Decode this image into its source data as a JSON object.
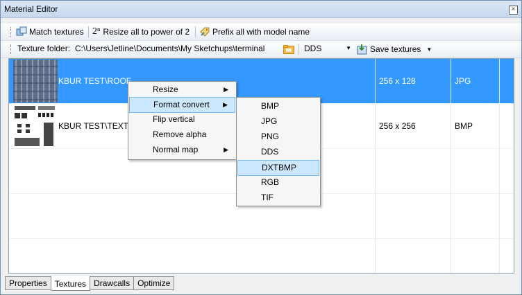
{
  "window": {
    "title": "Material Editor"
  },
  "toolbar1": {
    "match_textures": "Match textures",
    "resize_power2": "Resize all to power of 2",
    "power_symbol": "2ⁿ",
    "prefix_model_name": "Prefix all with model name"
  },
  "toolbar2": {
    "texture_folder_label": "Texture folder:",
    "texture_folder_path": "C:\\Users\\Jetline\\Documents\\My Sketchups\\terminal",
    "format_select": "DDS",
    "save_textures": "Save textures"
  },
  "textures": [
    {
      "name": "KBUR TEST\\ROOF_TILE.JPG",
      "name_visible": "KBUR TEST\\ROOF_",
      "size": "256 x 128",
      "format": "JPG",
      "selected": true
    },
    {
      "name": "KBUR TEST\\TEXTU",
      "size": "256 x 256",
      "format": "BMP",
      "selected": false
    }
  ],
  "context_menu": {
    "items": [
      {
        "label": "Resize",
        "submenu": true
      },
      {
        "label": "Format convert",
        "submenu": true,
        "highlighted": true
      },
      {
        "label": "Flip vertical",
        "submenu": false
      },
      {
        "label": "Remove alpha",
        "submenu": false
      },
      {
        "label": "Normal map",
        "submenu": true
      }
    ]
  },
  "format_submenu": {
    "items": [
      {
        "label": "BMP"
      },
      {
        "label": "JPG"
      },
      {
        "label": "PNG"
      },
      {
        "label": "DDS"
      },
      {
        "label": "DXTBMP",
        "highlighted": true
      },
      {
        "label": "RGB"
      },
      {
        "label": "TIF"
      }
    ]
  },
  "tabs": [
    {
      "label": "Properties",
      "active": false
    },
    {
      "label": "Textures",
      "active": true
    },
    {
      "label": "Drawcalls",
      "active": false
    },
    {
      "label": "Optimize",
      "active": false
    }
  ],
  "colors": {
    "selection": "#3399ff",
    "menu_highlight": "#cce8ff"
  }
}
